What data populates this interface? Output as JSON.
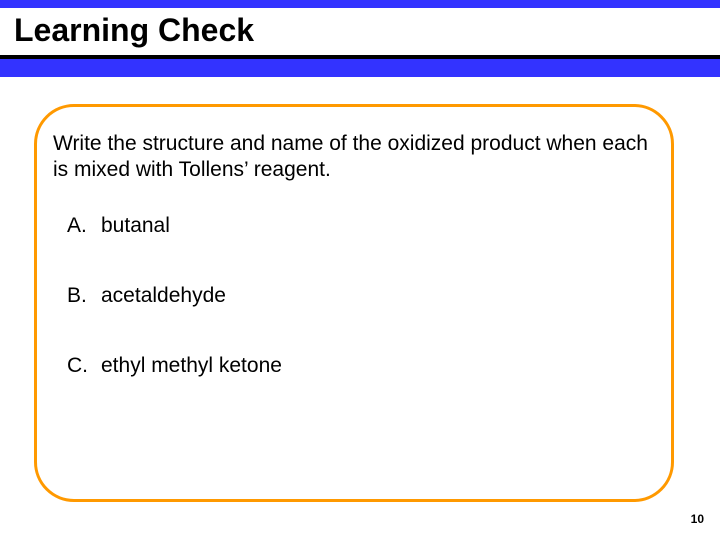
{
  "title": "Learning Check",
  "prompt": "Write the structure and name of the oxidized product when each is mixed with Tollens’ reagent.",
  "items": [
    {
      "letter": "A.",
      "text": "butanal"
    },
    {
      "letter": "B.",
      "text": "acetaldehyde"
    },
    {
      "letter": "C.",
      "text": "ethyl methyl ketone"
    }
  ],
  "page_number": "10"
}
